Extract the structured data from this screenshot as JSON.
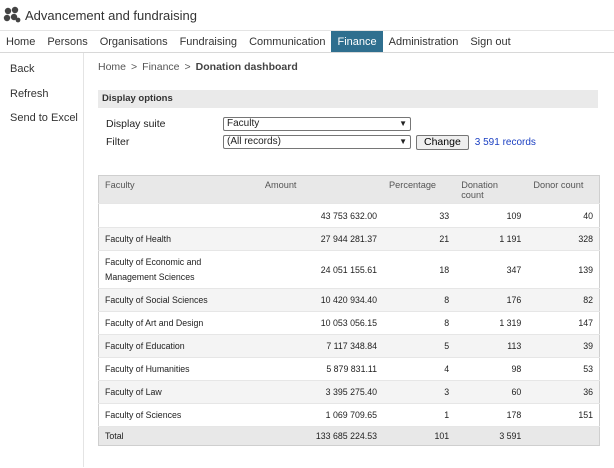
{
  "app": {
    "title": "Advancement and fundraising"
  },
  "menu": [
    "Home",
    "Persons",
    "Organisations",
    "Fundraising",
    "Communication",
    "Finance",
    "Administration",
    "Sign out"
  ],
  "active_menu": "Finance",
  "left_nav": [
    "Back",
    "Refresh",
    "Send to Excel"
  ],
  "breadcrumb": {
    "home": "Home",
    "finance": "Finance",
    "current": "Donation dashboard",
    "separator": ">"
  },
  "options": {
    "header": "Display options",
    "display_suite_label": "Display suite",
    "display_suite_value": "Faculty",
    "filter_label": "Filter",
    "filter_value": "(All records)",
    "change_button": "Change",
    "records": "3 591 records"
  },
  "table": {
    "headers": [
      "Faculty",
      "Amount",
      "Percentage",
      "Donation count",
      "Donor count"
    ],
    "rows": [
      [
        "",
        "43 753 632.00",
        "33",
        "109",
        "40"
      ],
      [
        "Faculty of Health",
        "27 944 281.37",
        "21",
        "1 191",
        "328"
      ],
      [
        "Faculty of Economic and Management Sciences",
        "24 051 155.61",
        "18",
        "347",
        "139"
      ],
      [
        "Faculty of Social Sciences",
        "10 420 934.40",
        "8",
        "176",
        "82"
      ],
      [
        "Faculty of Art and Design",
        "10 053 056.15",
        "8",
        "1 319",
        "147"
      ],
      [
        "Faculty of Education",
        "7 117 348.84",
        "5",
        "113",
        "39"
      ],
      [
        "Faculty of Humanities",
        "5 879 831.11",
        "4",
        "98",
        "53"
      ],
      [
        "Faculty of Law",
        "3 395 275.40",
        "3",
        "60",
        "36"
      ],
      [
        "Faculty of Sciences",
        "1 069 709.65",
        "1",
        "178",
        "151"
      ]
    ],
    "total": [
      "Total",
      "133 685 224.53",
      "101",
      "3 591",
      ""
    ]
  },
  "colors": {
    "active_menu_bg": "#2f6f8f",
    "link": "#1a3fc2",
    "header_bg": "#e8e8e8"
  }
}
